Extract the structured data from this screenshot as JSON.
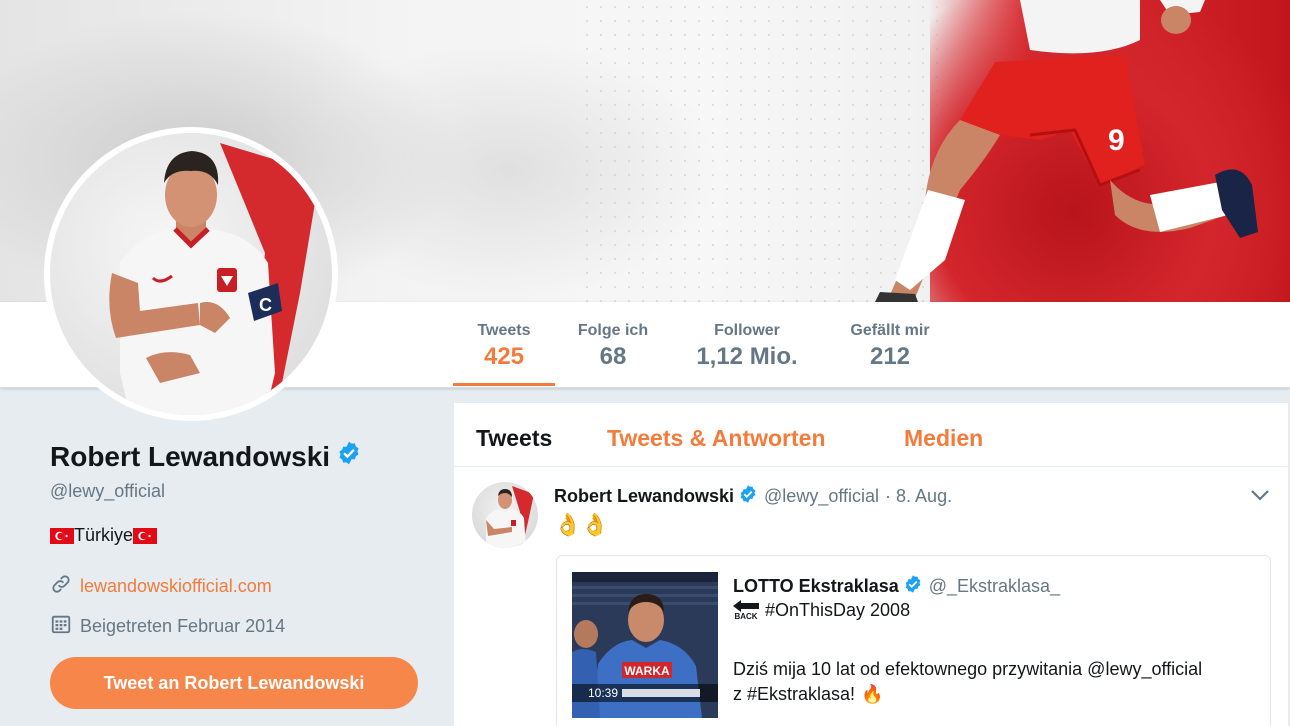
{
  "profile": {
    "name": "Robert Lewandowski",
    "handle": "@lewy_official",
    "location": "Türkiye",
    "url": "lewandowskiofficial.com",
    "joined": "Beigetreten Februar 2014",
    "tweet_to_label": "Tweet an Robert Lewandowski"
  },
  "stats": [
    {
      "label": "Tweets",
      "value": "425"
    },
    {
      "label": "Folge ich",
      "value": "68"
    },
    {
      "label": "Follower",
      "value": "1,12 Mio."
    },
    {
      "label": "Gefällt mir",
      "value": "212"
    }
  ],
  "tabs": [
    {
      "label": "Tweets"
    },
    {
      "label": "Tweets & Antworten"
    },
    {
      "label": "Medien"
    }
  ],
  "tweet": {
    "author": "Robert Lewandowski",
    "handle": "@lewy_official",
    "date": "· 8. Aug.",
    "text": "👌👌",
    "quote": {
      "author": "LOTTO Ekstraklasa",
      "handle": "@_Ekstraklasa_",
      "back_label": "BACK",
      "line1": "#OnThisDay 2008",
      "line2": "Dziś mija 10 lat od efektownego przywitania @lewy_official",
      "line3": "z #Ekstraklasa!",
      "emoji": "🔥",
      "media_sign": "WARKA",
      "media_time": "10:39"
    }
  },
  "colors": {
    "accent": "#f37b3b",
    "button": "#f6864a",
    "verified": "#1da1f2",
    "background": "#e6ecf0"
  },
  "icons": [
    "verified-badge-icon",
    "link-icon",
    "calendar-icon",
    "chevron-down-icon",
    "back-arrow-icon"
  ]
}
